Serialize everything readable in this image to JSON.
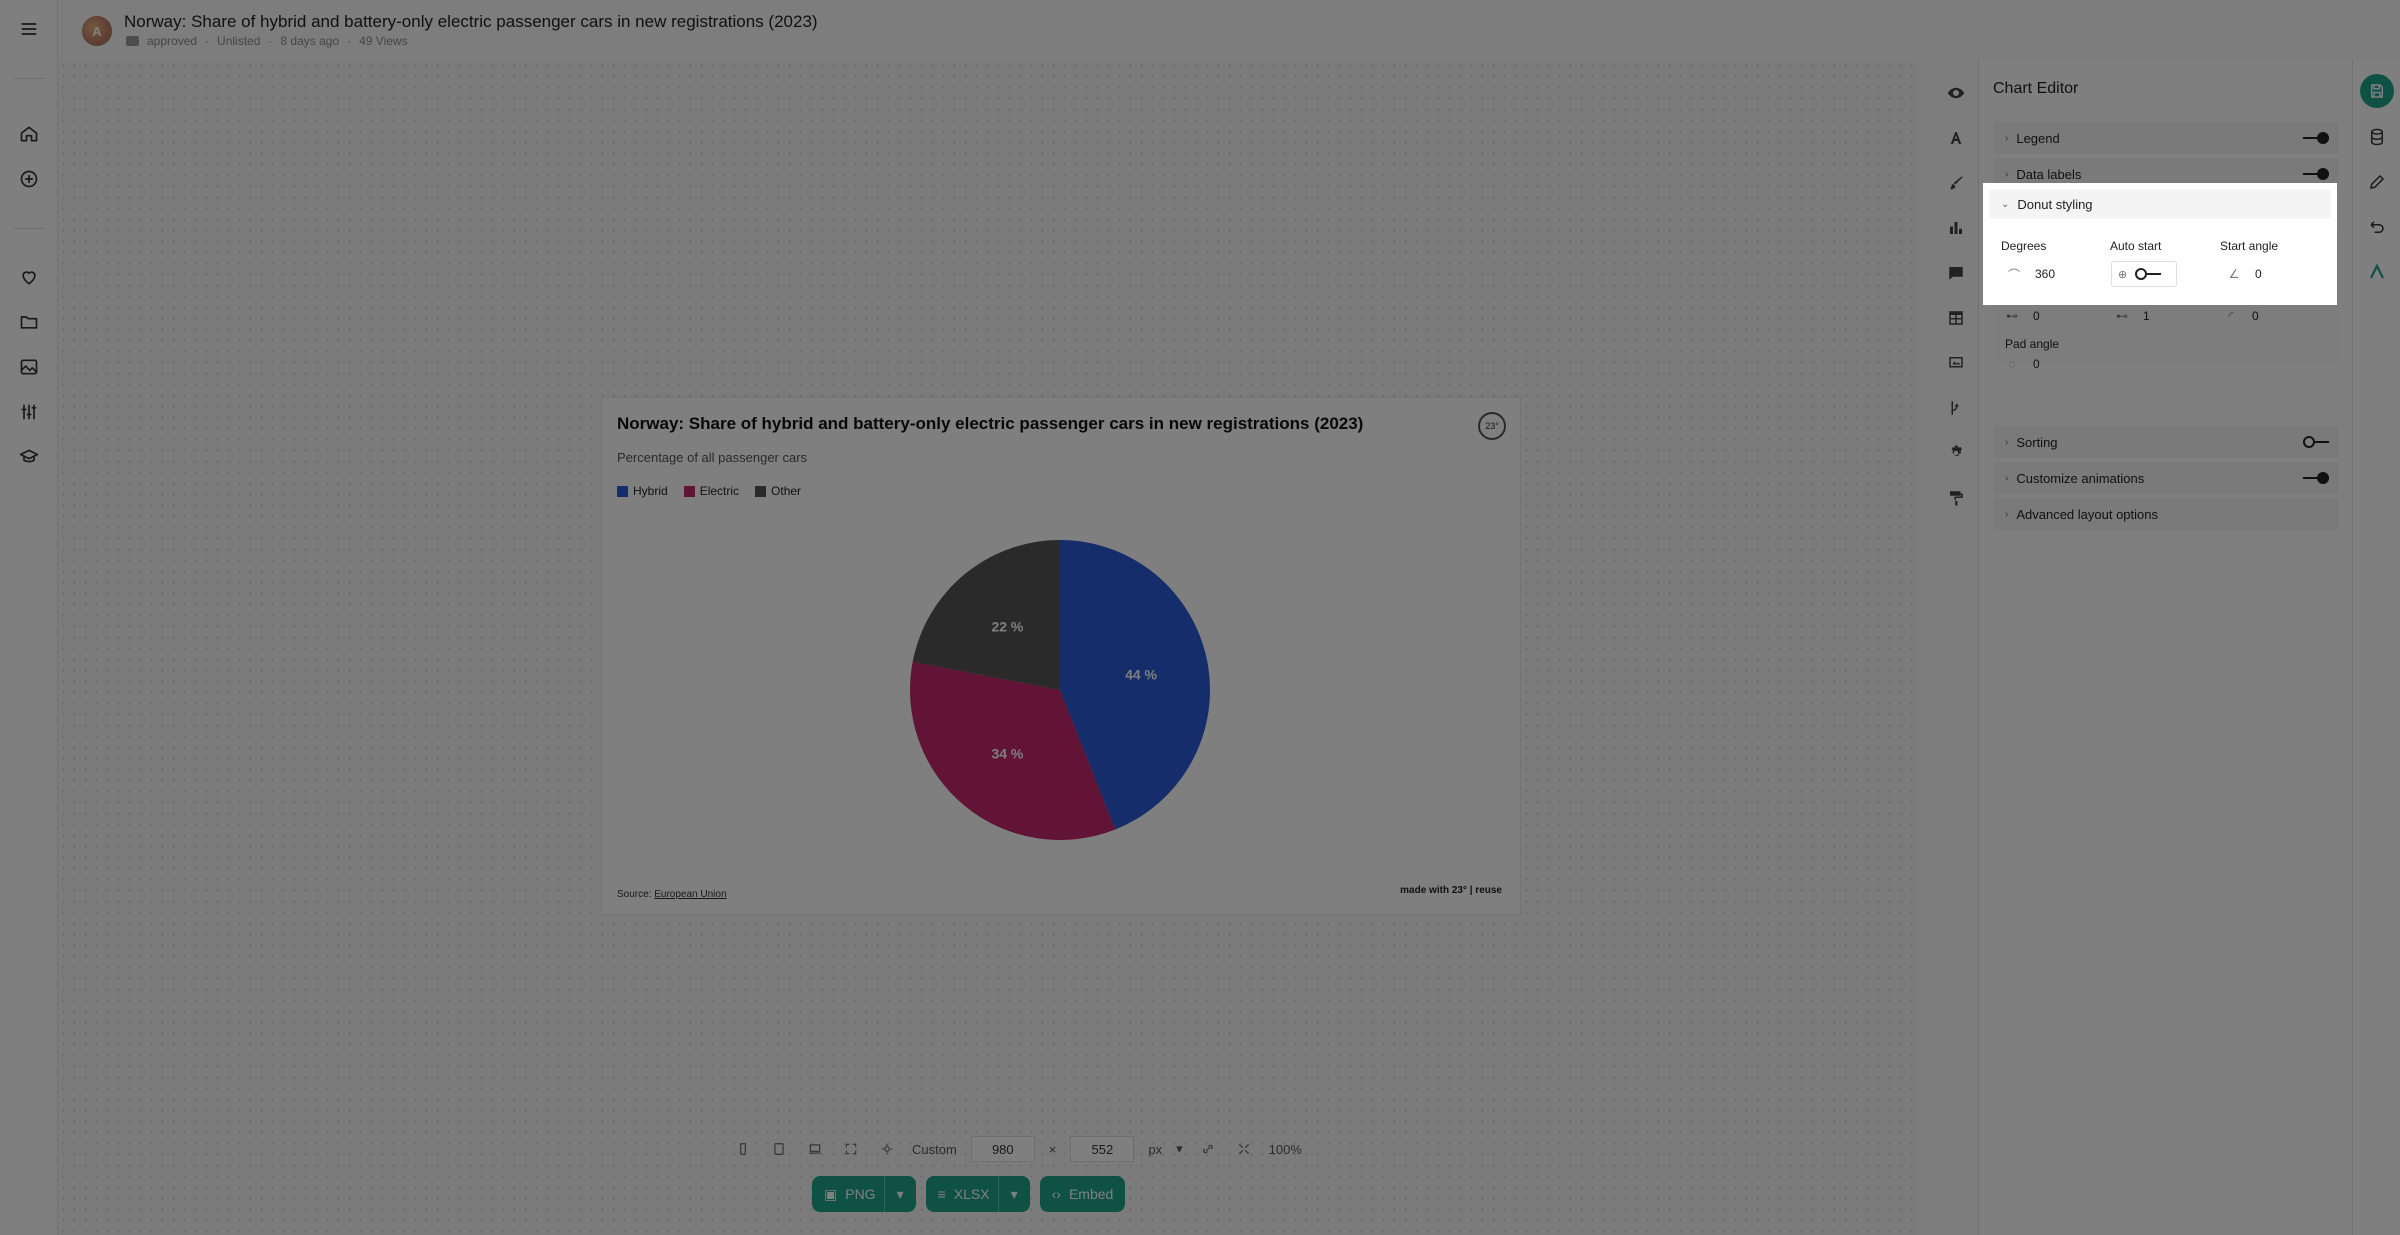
{
  "header": {
    "title": "Norway: Share of hybrid and battery-only electric passenger cars in new registrations (2023)",
    "status": "approved",
    "visibility": "Unlisted",
    "age": "8 days ago",
    "views": "49 Views",
    "avatar_initial": "A"
  },
  "chart": {
    "title": "Norway: Share of hybrid and battery-only electric passenger cars in new registrations (2023)",
    "subtitle": "Percentage of all passenger cars",
    "source_label": "Source:",
    "source_link": "European Union",
    "made_with": "made with 23° | reuse",
    "brand_badge": "23°"
  },
  "chart_data": {
    "type": "pie",
    "categories": [
      "Hybrid",
      "Electric",
      "Other"
    ],
    "values": [
      44,
      34,
      22
    ],
    "value_labels": [
      "44 %",
      "34 %",
      "22 %"
    ],
    "colors": [
      "#2b5cd6",
      "#c2286c",
      "#555555"
    ],
    "title": "Norway: Share of hybrid and battery-only electric passenger cars in new registrations (2023)",
    "subtitle": "Percentage of all passenger cars",
    "legend_position": "top-left"
  },
  "toolbar": {
    "preset": "Custom",
    "width": "980",
    "height": "552",
    "unit": "px",
    "zoom": "100%",
    "times": "×"
  },
  "export": {
    "png": "PNG",
    "xlsx": "XLSX",
    "embed": "Embed"
  },
  "editor": {
    "title": "Chart Editor",
    "sections": {
      "legend": "Legend",
      "data_labels": "Data labels",
      "donut_styling": "Donut styling",
      "sorting": "Sorting",
      "animations": "Customize animations",
      "advanced": "Advanced layout options"
    },
    "donut": {
      "degrees_label": "Degrees",
      "degrees_value": "360",
      "auto_start_label": "Auto start",
      "start_angle_label": "Start angle",
      "start_angle_value": "0",
      "inner_value": "0",
      "outer_value": "1",
      "corner_value": "0",
      "pad_angle_label": "Pad angle",
      "pad_angle_value": "0"
    }
  }
}
